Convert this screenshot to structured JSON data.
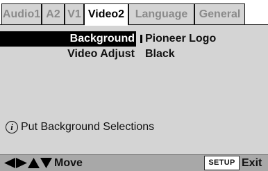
{
  "tabs": [
    {
      "label": "Audio1",
      "active": false
    },
    {
      "label": "A2",
      "active": false
    },
    {
      "label": "V1",
      "active": false
    },
    {
      "label": "Video2",
      "active": true
    },
    {
      "label": "Language",
      "active": false
    },
    {
      "label": "General",
      "active": false
    }
  ],
  "settings": [
    {
      "label": "Background",
      "value": "Pioneer Logo",
      "selected": true
    },
    {
      "label": "Video Adjust",
      "value": "Black",
      "selected": false
    }
  ],
  "help": {
    "icon": "info-icon",
    "text": "Put Background Selections"
  },
  "footer": {
    "nav_icons": [
      "left-arrow-icon",
      "right-arrow-icon",
      "up-arrow-icon",
      "down-arrow-icon"
    ],
    "move_label": "Move",
    "setup_key": "SETUP",
    "exit_label": "Exit"
  },
  "colors": {
    "panel": "#d4d4d4",
    "selection": "#000000",
    "footer": "#a8a8a8",
    "inactive_tab_text": "#8a8a8a"
  }
}
